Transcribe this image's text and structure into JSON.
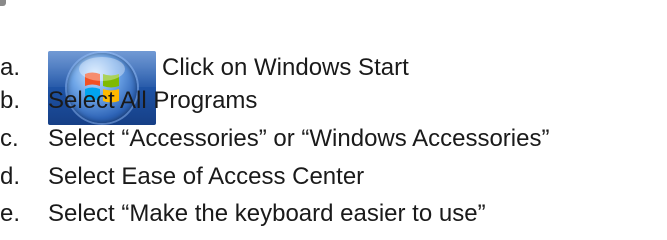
{
  "steps": [
    {
      "letter": "a.",
      "text": "Click on Windows Start",
      "icon": "windows-start-icon"
    },
    {
      "letter": "b.",
      "text": "Select All Programs"
    },
    {
      "letter": "c.",
      "text": "Select “Accessories” or “Windows Accessories”"
    },
    {
      "letter": "d.",
      "text": "Select Ease of Access Center"
    },
    {
      "letter": "e.",
      "text": "Select “Make the keyboard easier to use”"
    }
  ],
  "colors": {
    "text": "#1a1a1a",
    "start_button": "#1f55a8",
    "logo_red": "#f25022",
    "logo_green": "#7fba00",
    "logo_blue": "#00a4ef",
    "logo_yellow": "#ffb900"
  }
}
